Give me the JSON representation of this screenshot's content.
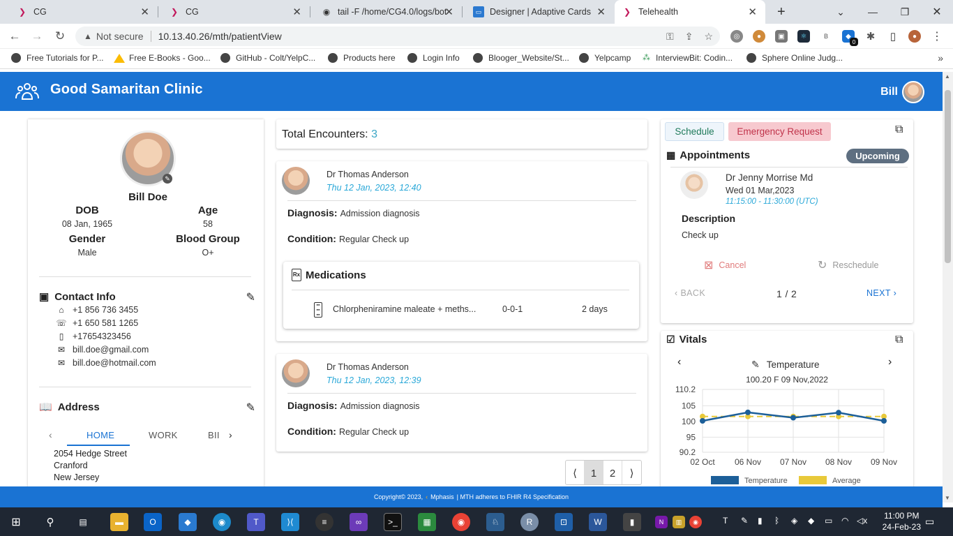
{
  "browser": {
    "tabs": [
      {
        "title": "CG",
        "icon": "cg-icon"
      },
      {
        "title": "CG",
        "icon": "cg-icon"
      },
      {
        "title": "tail -F /home/CG4.0/logs/bot",
        "icon": "github-icon"
      },
      {
        "title": "Designer | Adaptive Cards",
        "icon": "adaptive-cards-icon"
      },
      {
        "title": "Telehealth",
        "icon": "telehealth-icon",
        "active": true
      }
    ],
    "new_tab": "+",
    "not_secure": "Not secure",
    "url": "10.13.40.26/mth/patientView",
    "bookmarks": [
      "Free Tutorials for P...",
      "Free E-Books - Goo...",
      "GitHub - Colt/YelpC...",
      "Products here",
      "Login Info",
      "Blooger_Website/St...",
      "Yelpcamp",
      "InterviewBit: Codin...",
      "Sphere Online Judg..."
    ],
    "more": "»",
    "ext_badge": "0"
  },
  "app": {
    "brand": "Good Samaritan Clinic",
    "user": "Bill",
    "brand_color": "#1a73d3"
  },
  "patient": {
    "name": "Bill Doe",
    "dob_label": "DOB",
    "dob": "08 Jan, 1965",
    "age_label": "Age",
    "age": "58",
    "gender_label": "Gender",
    "gender": "Male",
    "blood_label": "Blood Group",
    "blood": "O+",
    "contact_title": "Contact Info",
    "contacts": [
      {
        "icon": "home-phone-icon",
        "value": "+1 856 736 3455"
      },
      {
        "icon": "work-phone-icon",
        "value": "+1 650 581 1265"
      },
      {
        "icon": "mobile-phone-icon",
        "value": "+17654323456"
      },
      {
        "icon": "email-icon",
        "value": "bill.doe@gmail.com"
      },
      {
        "icon": "email-icon",
        "value": "bill.doe@hotmail.com"
      }
    ],
    "address_title": "Address",
    "address_tabs": [
      "HOME",
      "WORK",
      "BII"
    ],
    "address_lines": [
      "2054 Hedge Street",
      "Cranford",
      "New Jersey"
    ]
  },
  "encounters": {
    "label": "Total Encounters:",
    "count": "3",
    "diagnosis_label": "Diagnosis:",
    "condition_label": "Condition:",
    "items": [
      {
        "doctor": "Dr Thomas Anderson",
        "time": "Thu 12 Jan, 2023, 12:40",
        "diagnosis": "Admission diagnosis",
        "condition": "Regular Check up",
        "medications_title": "Medications",
        "medications": [
          {
            "name": "Chlorpheniramine maleate + meths...",
            "dose": "0-0-1",
            "duration": "2 days"
          }
        ]
      },
      {
        "doctor": "Dr Thomas Anderson",
        "time": "Thu 12 Jan, 2023, 12:39",
        "diagnosis": "Admission diagnosis",
        "condition": "Regular Check up"
      }
    ],
    "pager": {
      "prev": "⟨",
      "pages": [
        "1",
        "2"
      ],
      "next": "⟩",
      "current": "1"
    }
  },
  "appointments": {
    "schedule_btn": "Schedule",
    "emergency_btn": "Emergency Request",
    "title": "Appointments",
    "status": "Upcoming",
    "doctor": "Dr Jenny Morrise Md",
    "date": "Wed 01 Mar,2023",
    "time": "11:15:00 - 11:30:00 (UTC)",
    "desc_label": "Description",
    "desc": "Check up",
    "cancel": "Cancel",
    "reschedule": "Reschedule",
    "back": "BACK",
    "page": "1 / 2",
    "next": "NEXT"
  },
  "vitals": {
    "title": "Vitals",
    "vital": "Temperature",
    "reading": "100.20 F  09 Nov,2022"
  },
  "chart_data": {
    "type": "line",
    "x": [
      "02 Oct",
      "06 Nov",
      "07 Nov",
      "08 Nov",
      "09 Nov"
    ],
    "yticks": [
      "110.2",
      "105",
      "100",
      "95",
      "90.2"
    ],
    "ylim": [
      90.2,
      110.2
    ],
    "series": [
      {
        "name": "Temperature",
        "color": "#1c5f99",
        "values": [
          100.2,
          102.9,
          101.2,
          102.8,
          100.2
        ]
      },
      {
        "name": "Average",
        "color": "#e8c93a",
        "dashed": true,
        "values": [
          101.6,
          101.6,
          101.6,
          101.6,
          101.6
        ]
      }
    ],
    "grid": true,
    "legend": "bottom"
  },
  "footer": {
    "copyright": "Copyright© 2023,",
    "company": "Mphasis",
    "tagline": "|  MTH adheres to FHIR R4 Specification"
  },
  "taskbar": {
    "time": "11:00 PM",
    "date": "24-Feb-23"
  }
}
